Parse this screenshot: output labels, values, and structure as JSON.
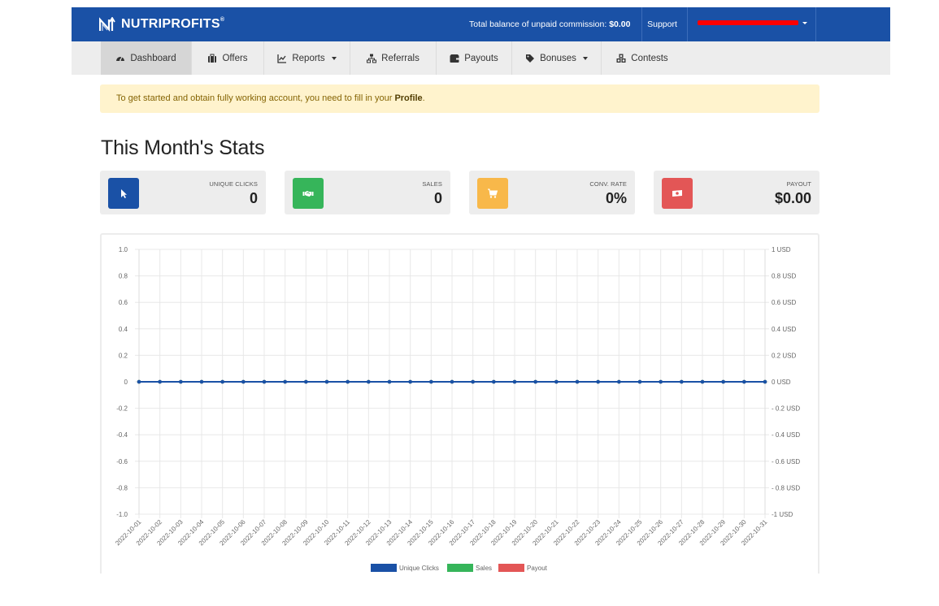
{
  "header": {
    "brand": "NUTRIPROFITS",
    "brand_mark": "®",
    "balance_label": "Total balance of unpaid commission:",
    "balance_value": "$0.00",
    "support_label": "Support",
    "user_name_redacted": true,
    "colors": {
      "primary": "#1a51a6",
      "redaction": "#ff0000"
    }
  },
  "nav": {
    "items": [
      {
        "label": "Dashboard",
        "icon": "tachometer-icon",
        "active": true,
        "dropdown": false
      },
      {
        "label": "Offers",
        "icon": "briefcase-icon",
        "active": false,
        "dropdown": false
      },
      {
        "label": "Reports",
        "icon": "line-chart-icon",
        "active": false,
        "dropdown": true
      },
      {
        "label": "Referrals",
        "icon": "sitemap-icon",
        "active": false,
        "dropdown": false
      },
      {
        "label": "Payouts",
        "icon": "wallet-icon",
        "active": false,
        "dropdown": false
      },
      {
        "label": "Bonuses",
        "icon": "tag-icon",
        "active": false,
        "dropdown": true
      },
      {
        "label": "Contests",
        "icon": "cubes-icon",
        "active": false,
        "dropdown": false
      }
    ]
  },
  "alert": {
    "text": "To get started and obtain fully working account, you need to fill in your ",
    "link_text": "Profile",
    "suffix": "."
  },
  "page_title": "This Month's Stats",
  "stats": [
    {
      "label": "UNIQUE CLICKS",
      "value": "0",
      "icon": "cursor-icon",
      "color": "#1a51a6"
    },
    {
      "label": "SALES",
      "value": "0",
      "icon": "handshake-icon",
      "color": "#36b55a"
    },
    {
      "label": "CONV. RATE",
      "value": "0%",
      "icon": "cart-icon",
      "color": "#f8b84a"
    },
    {
      "label": "PAYOUT",
      "value": "$0.00",
      "icon": "money-icon",
      "color": "#e35656"
    }
  ],
  "chart_data": {
    "type": "line",
    "title": "",
    "x": [
      "2022-10-01",
      "2022-10-02",
      "2022-10-03",
      "2022-10-04",
      "2022-10-05",
      "2022-10-06",
      "2022-10-07",
      "2022-10-08",
      "2022-10-09",
      "2022-10-10",
      "2022-10-11",
      "2022-10-12",
      "2022-10-13",
      "2022-10-14",
      "2022-10-15",
      "2022-10-16",
      "2022-10-17",
      "2022-10-18",
      "2022-10-19",
      "2022-10-20",
      "2022-10-21",
      "2022-10-22",
      "2022-10-23",
      "2022-10-24",
      "2022-10-25",
      "2022-10-26",
      "2022-10-27",
      "2022-10-28",
      "2022-10-29",
      "2022-10-30",
      "2022-10-31"
    ],
    "series": [
      {
        "name": "Unique Clicks",
        "color": "#1a51a6",
        "axis": "left",
        "values": [
          0,
          0,
          0,
          0,
          0,
          0,
          0,
          0,
          0,
          0,
          0,
          0,
          0,
          0,
          0,
          0,
          0,
          0,
          0,
          0,
          0,
          0,
          0,
          0,
          0,
          0,
          0,
          0,
          0,
          0,
          0
        ]
      },
      {
        "name": "Sales",
        "color": "#36b55a",
        "axis": "left",
        "values": [
          0,
          0,
          0,
          0,
          0,
          0,
          0,
          0,
          0,
          0,
          0,
          0,
          0,
          0,
          0,
          0,
          0,
          0,
          0,
          0,
          0,
          0,
          0,
          0,
          0,
          0,
          0,
          0,
          0,
          0,
          0
        ]
      },
      {
        "name": "Payout",
        "color": "#e35656",
        "axis": "right",
        "values": [
          0,
          0,
          0,
          0,
          0,
          0,
          0,
          0,
          0,
          0,
          0,
          0,
          0,
          0,
          0,
          0,
          0,
          0,
          0,
          0,
          0,
          0,
          0,
          0,
          0,
          0,
          0,
          0,
          0,
          0,
          0
        ]
      }
    ],
    "ylim": [
      -1,
      1
    ],
    "yticks_left": [
      "1.0",
      "0.8",
      "0.6",
      "0.4",
      "0.2",
      "0",
      "-0.2",
      "-0.4",
      "-0.6",
      "-0.8",
      "-1.0"
    ],
    "yticks_right": [
      "1 USD",
      "0.8 USD",
      "0.6 USD",
      "0.4 USD",
      "0.2 USD",
      "0 USD",
      "- 0.2 USD",
      "- 0.4 USD",
      "- 0.6 USD",
      "- 0.8 USD",
      "-1 USD"
    ],
    "xlabel": "",
    "ylabel": "",
    "grid": true,
    "legend": "bottom"
  }
}
